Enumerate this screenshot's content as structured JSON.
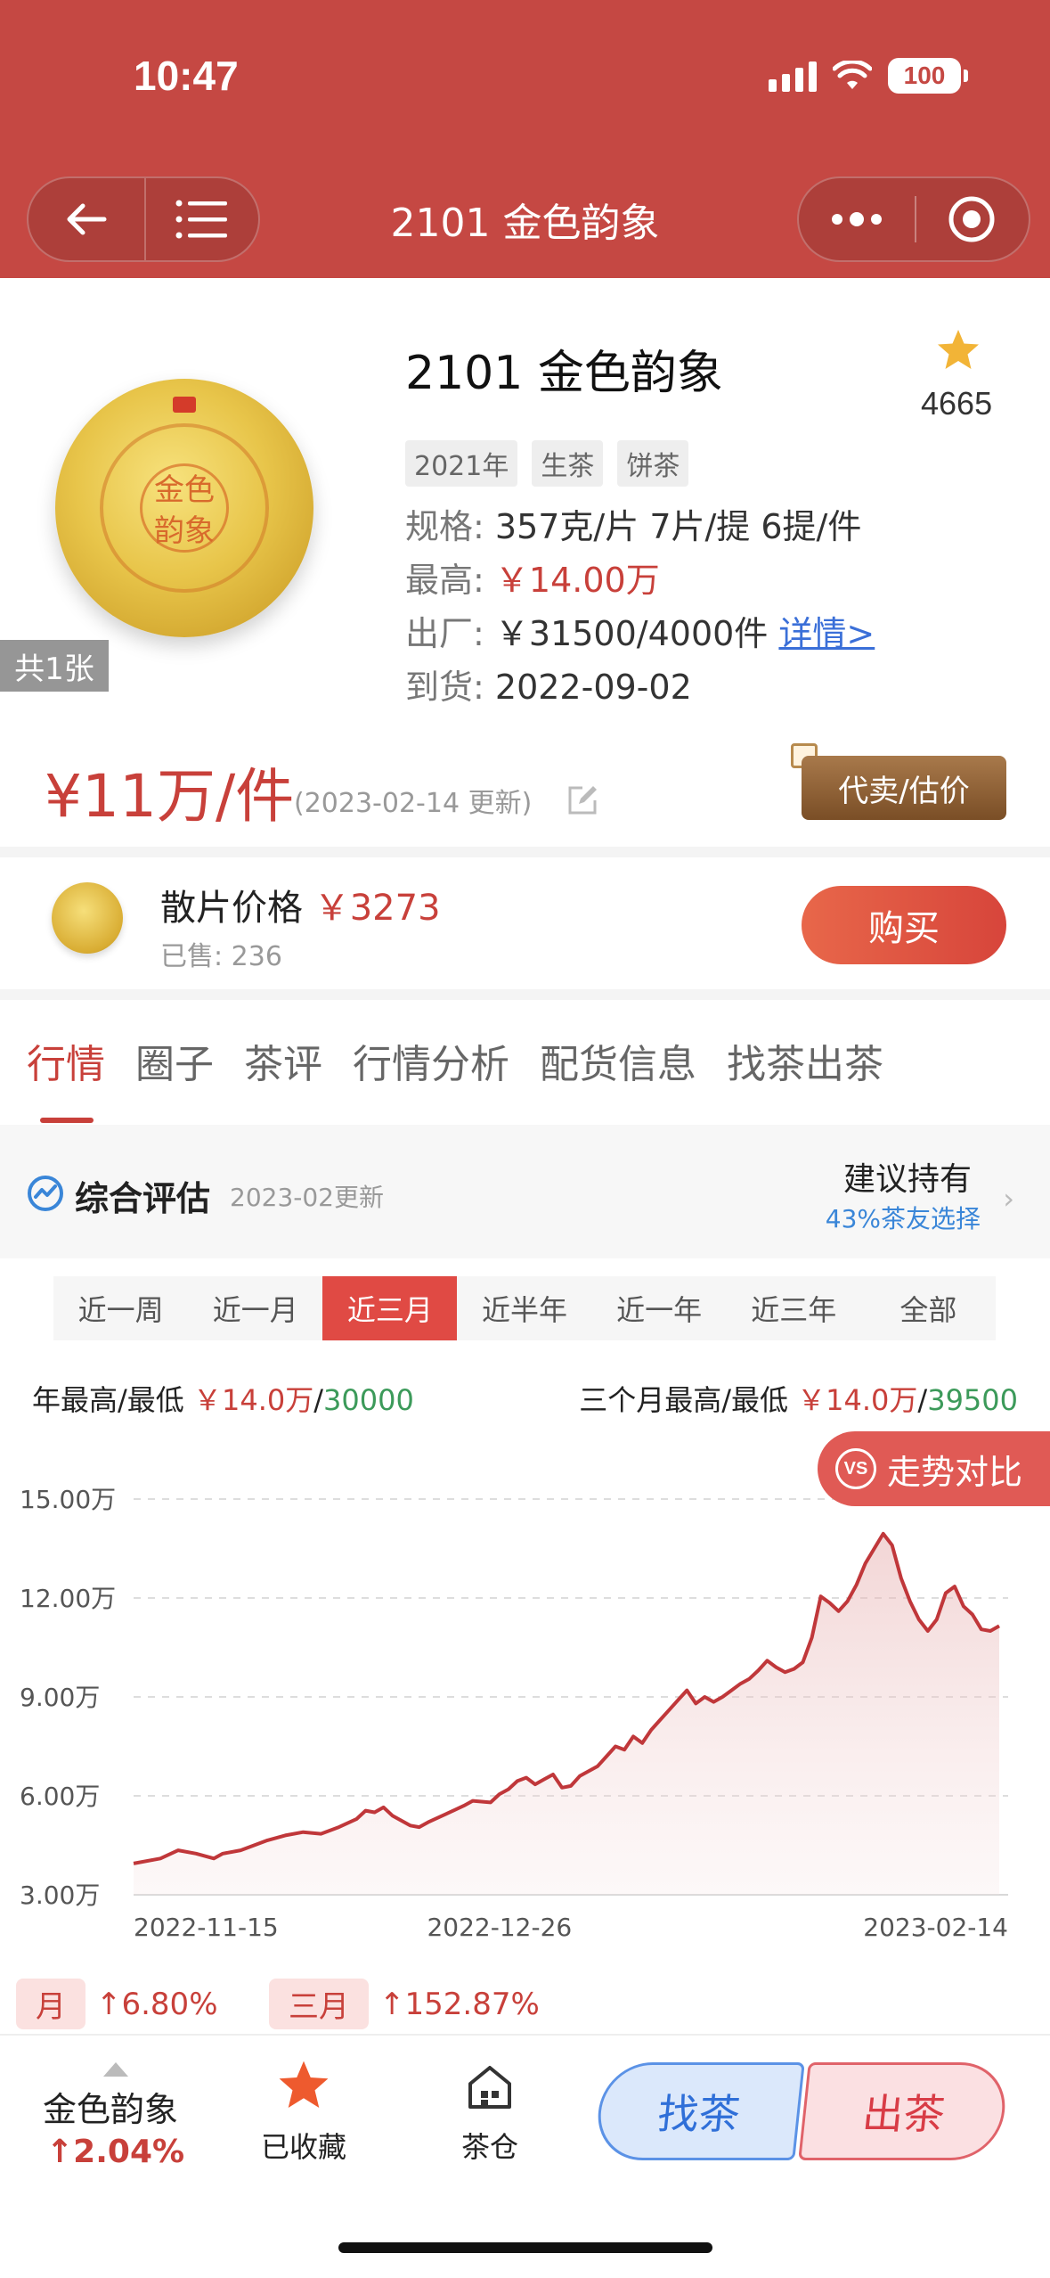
{
  "status": {
    "time": "10:47",
    "battery": "100"
  },
  "nav": {
    "title": "2101 金色韵象"
  },
  "product": {
    "name": "2101 金色韵象",
    "fav_count": "4665",
    "image_count": "共1张",
    "cake_text": "金色韵象",
    "tags": [
      "2021年",
      "生茶",
      "饼茶"
    ],
    "spec_label": "规格:",
    "spec_value": "357克/片 7片/提 6提/件",
    "high_label": "最高:",
    "high_value": "￥14.00万",
    "factory_label": "出厂:",
    "factory_value": "￥31500/4000件",
    "details_link": "详情>",
    "arrival_label": "到货:",
    "arrival_value": "2022-09-02",
    "price": "¥11万/件",
    "price_update": "(2023-02-14 更新)",
    "consign_label": "代卖/估价"
  },
  "loose": {
    "label": "散片价格",
    "price": "￥3273",
    "sold": "已售: 236",
    "buy_label": "购买"
  },
  "tabs": [
    "行情",
    "圈子",
    "茶评",
    "行情分析",
    "配货信息",
    "找茶出茶"
  ],
  "active_tab": 0,
  "evaluation": {
    "title": "综合评估",
    "date": "2023-02更新",
    "recommendation": "建议持有",
    "percent": "43%茶友选择"
  },
  "periods": [
    "近一周",
    "近一月",
    "近三月",
    "近半年",
    "近一年",
    "近三年",
    "全部"
  ],
  "active_period": 2,
  "hilo": {
    "year_label": "年最高/最低",
    "year_high": "￥14.0万",
    "year_low": "30000",
    "three_month_label": "三个月最高/最低",
    "three_month_high": "￥14.0万",
    "three_month_low": "39500",
    "sep": "/"
  },
  "trend_compare": {
    "vs": "VS",
    "label": "走势对比"
  },
  "chart_data": {
    "type": "area",
    "title": "",
    "xlabel": "",
    "ylabel": "",
    "ylim": [
      30000,
      150000
    ],
    "y_ticks": [
      "3.00万",
      "6.00万",
      "9.00万",
      "12.00万",
      "15.00万"
    ],
    "y_tick_values": [
      30000,
      60000,
      90000,
      120000,
      150000
    ],
    "x_ticks": [
      "2022-11-15",
      "2022-12-26",
      "2023-02-14"
    ],
    "x_tick_values": [
      0,
      41,
      91
    ],
    "grid": true,
    "line_color": "#c0373a",
    "series": [
      {
        "values": [
          [
            0,
            39500
          ],
          [
            3,
            41000
          ],
          [
            5,
            43500
          ],
          [
            7,
            42500
          ],
          [
            9,
            41000
          ],
          [
            10,
            42500
          ],
          [
            12,
            43500
          ],
          [
            14,
            45500
          ],
          [
            15,
            46500
          ],
          [
            17,
            48000
          ],
          [
            19,
            49000
          ],
          [
            21,
            48500
          ],
          [
            23,
            50500
          ],
          [
            25,
            53000
          ],
          [
            26,
            55500
          ],
          [
            27,
            55000
          ],
          [
            28,
            56500
          ],
          [
            29,
            54000
          ],
          [
            30,
            52500
          ],
          [
            31,
            51000
          ],
          [
            32,
            50500
          ],
          [
            33,
            52000
          ],
          [
            35,
            54500
          ],
          [
            37,
            57000
          ],
          [
            38,
            58500
          ],
          [
            40,
            58000
          ],
          [
            41,
            60500
          ],
          [
            42,
            62000
          ],
          [
            43,
            64500
          ],
          [
            44,
            65500
          ],
          [
            45,
            63500
          ],
          [
            46,
            65000
          ],
          [
            47,
            66500
          ],
          [
            48,
            62500
          ],
          [
            49,
            63000
          ],
          [
            50,
            66000
          ],
          [
            52,
            69000
          ],
          [
            53,
            72000
          ],
          [
            54,
            75000
          ],
          [
            55,
            74000
          ],
          [
            56,
            78000
          ],
          [
            57,
            76000
          ],
          [
            58,
            80000
          ],
          [
            59,
            83000
          ],
          [
            60,
            86000
          ],
          [
            61,
            89000
          ],
          [
            62,
            92000
          ],
          [
            63,
            88000
          ],
          [
            64,
            90000
          ],
          [
            65,
            88500
          ],
          [
            66,
            90000
          ],
          [
            67,
            92000
          ],
          [
            68,
            94000
          ],
          [
            69,
            95500
          ],
          [
            70,
            98000
          ],
          [
            71,
            101000
          ],
          [
            72,
            99000
          ],
          [
            73,
            97500
          ],
          [
            74,
            98500
          ],
          [
            75,
            100500
          ],
          [
            76,
            108000
          ],
          [
            77,
            120500
          ],
          [
            78,
            118500
          ],
          [
            79,
            116000
          ],
          [
            80,
            119000
          ],
          [
            81,
            124000
          ],
          [
            82,
            130500
          ],
          [
            83,
            135000
          ],
          [
            84,
            139500
          ],
          [
            85,
            136000
          ],
          [
            86,
            126000
          ],
          [
            87,
            119000
          ],
          [
            88,
            113500
          ],
          [
            89,
            110000
          ],
          [
            90,
            113500
          ],
          [
            91,
            121500
          ],
          [
            92,
            123500
          ],
          [
            93,
            117500
          ],
          [
            94,
            115000
          ],
          [
            95,
            110500
          ],
          [
            96,
            110000
          ],
          [
            97,
            111500
          ]
        ]
      }
    ]
  },
  "changes": [
    {
      "label": "月",
      "value": "↑6.80%"
    },
    {
      "label": "三月",
      "value": "↑152.87%"
    }
  ],
  "bottom": {
    "name": "金色韵象",
    "pct": "↑2.04%",
    "favorited": "已收藏",
    "warehouse": "茶仓",
    "find_tea": "找茶",
    "sell_tea": "出茶"
  },
  "colors": {
    "header": "#c54843",
    "accent_red": "#c8403a",
    "green": "#3c9a5a",
    "blue": "#3a86d8"
  }
}
